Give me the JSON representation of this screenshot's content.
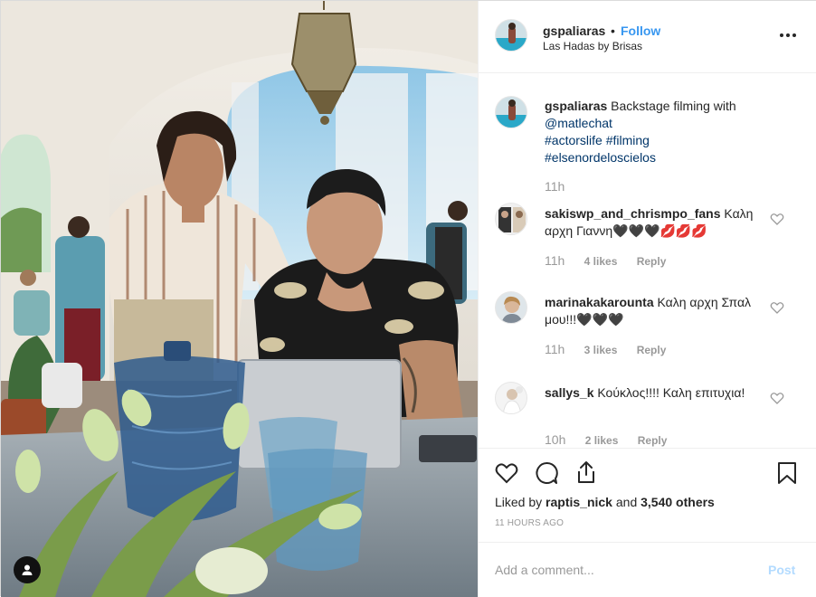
{
  "post": {
    "username": "gspaliaras",
    "separator": "•",
    "follow_label": "Follow",
    "location": "Las Hadas by Brisas",
    "more_icon": "more-options-icon"
  },
  "caption": {
    "username": "gspaliaras",
    "text_before": "Backstage filming with",
    "mention": "@matlechat",
    "hashtags_line1": "#actorslife #filming",
    "hashtags_line2": "#elsenordeloscielos",
    "time": "11h"
  },
  "comments": [
    {
      "username": "sakiswp_and_chrismpo_fans",
      "text": "Καλη αρχη Γιαννη🖤🖤🖤💋💋💋",
      "time": "11h",
      "likes": "4 likes",
      "reply": "Reply"
    },
    {
      "username": "marinakakarounta",
      "text": "Καλη αρχη Σπαλ μου!!!🖤🖤🖤",
      "time": "11h",
      "likes": "3 likes",
      "reply": "Reply"
    },
    {
      "username": "sallys_k",
      "text": "Κούκλος!!!! Καλη επιτυχια!",
      "time": "10h",
      "likes": "2 likes",
      "reply": "Reply"
    }
  ],
  "actions": {
    "liked_prefix": "Liked by",
    "liked_user": "raptis_nick",
    "liked_suffix": "and",
    "liked_count": "3,540 others",
    "timestamp": "11 HOURS AGO"
  },
  "composer": {
    "placeholder": "Add a comment...",
    "post_label": "Post"
  },
  "colors": {
    "accent": "#3897f0",
    "post_disabled": "#b3dbff",
    "muted": "#999999"
  }
}
